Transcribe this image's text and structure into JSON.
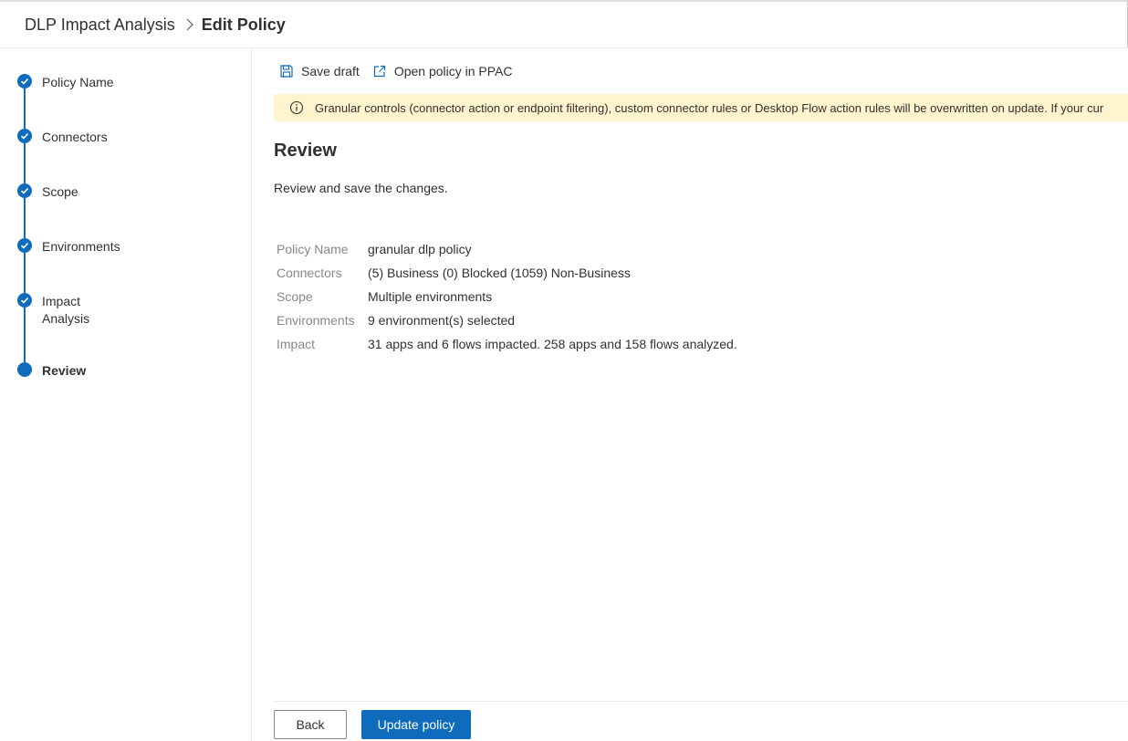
{
  "breadcrumb": {
    "root": "DLP Impact Analysis",
    "current": "Edit Policy"
  },
  "steps": [
    {
      "label": "Policy Name",
      "state": "completed"
    },
    {
      "label": "Connectors",
      "state": "completed"
    },
    {
      "label": "Scope",
      "state": "completed"
    },
    {
      "label": "Environments",
      "state": "completed"
    },
    {
      "label": "Impact\nAnalysis",
      "state": "completed"
    },
    {
      "label": "Review",
      "state": "current"
    }
  ],
  "toolbar": {
    "save_draft": "Save draft",
    "open_policy": "Open policy in PPAC"
  },
  "banner": {
    "message": "Granular controls (connector action or endpoint filtering), custom connector rules or Desktop Flow action rules will be overwritten on update. If your cur"
  },
  "review": {
    "title": "Review",
    "description": "Review and save the changes.",
    "summary": [
      {
        "key": "Policy Name",
        "value": "granular dlp policy"
      },
      {
        "key": "Connectors",
        "value": "(5) Business (0) Blocked (1059) Non-Business"
      },
      {
        "key": "Scope",
        "value": "Multiple environments"
      },
      {
        "key": "Environments",
        "value": "9 environment(s) selected"
      },
      {
        "key": "Impact",
        "value": "31 apps and 6 flows impacted. 258 apps and 158 flows analyzed."
      }
    ]
  },
  "footer": {
    "back": "Back",
    "update": "Update policy"
  },
  "colors": {
    "accent": "#0f6cbd",
    "banner_bg": "#fff4ce",
    "muted_text": "#8a8886"
  }
}
